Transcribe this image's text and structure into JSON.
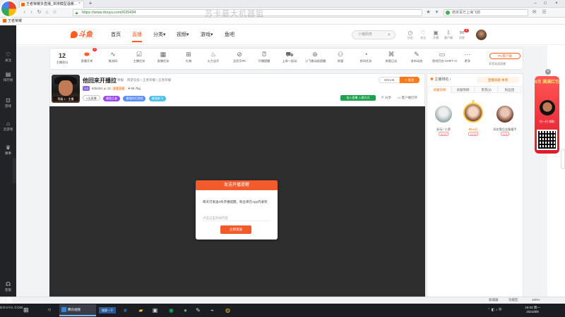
{
  "browser": {
    "tab_title": "王者荣耀多直播_单排模型温暖...",
    "url": "https://www.douyu.com/635434",
    "search_engine_text": "南京百万上海飞鸽",
    "watermark": "苏卡最大机器狙",
    "bookmark": "王者荣耀"
  },
  "sidebar": {
    "items": [
      {
        "icon": "heart-icon",
        "label": "关注"
      },
      {
        "icon": "list-icon",
        "label": "排行榜"
      },
      {
        "icon": "gamepad-icon",
        "label": "游戏"
      },
      {
        "icon": "store-icon",
        "label": "云游戏"
      },
      {
        "icon": "trophy-icon",
        "label": "赛事"
      },
      {
        "icon": "headset-icon",
        "label": "客服"
      }
    ]
  },
  "nav": {
    "items": [
      "首页",
      "直播",
      "分类",
      "视频",
      "游戏",
      "鱼吧"
    ],
    "search_placeholder": "小猪佩奇",
    "header_icons": [
      "历史",
      "关注",
      "开播",
      "客户端",
      "消息"
    ]
  },
  "features": {
    "level_num": "12",
    "level_label": "主播积分",
    "badge": "2",
    "items": [
      "直播开关",
      "推流码",
      "主播任务",
      "直播任务",
      "礼物",
      "火力全开",
      "全民乐PK",
      "开播提醒",
      "上车一起玩",
      "小飞猪动画提醒",
      "房管",
      "房间任务",
      "房管日志",
      "发布动态",
      "鱼吧开启 SHIFT+C",
      "更多"
    ],
    "pc_client": "PC客户端",
    "pc_sub": "享受高清直播"
  },
  "room": {
    "title": "他回来开播拉",
    "tag": "举报",
    "category": "网游竞技 • 王者荣耀 • 王者荣耀",
    "id_pill": "1:3",
    "hot": "12",
    "uid_label": "635434",
    "report": "查看直播",
    "fans": "68.7kg",
    "level_text": "V 1 级人",
    "tags": [
      "V当直播",
      "最强王者",
      "最强的打游戏",
      "最强带飞"
    ],
    "follow_count": "345146",
    "follow_label": "关注",
    "fans_btn": "加入直播 入群方式",
    "share": "分享",
    "client_watch": "客户端打开",
    "avatar_level": "等级 1 · 主播"
  },
  "modal": {
    "title": "发送开播提醒",
    "desc": "每天可发送3条开播提醒，粉丝将在App内收到",
    "input_placeholder": "点击这里添加内容",
    "button": "立即发送"
  },
  "rightpanel": {
    "ranks_label": "主播排名",
    "weekly_label": "直播贡献 本周",
    "tabs": [
      "贡献日榜",
      "贡献周榜",
      "贵宾(2)",
      "粉丝团"
    ],
    "users": [
      {
        "name": "多玩 / 小萝",
        "badge": "LV.12"
      },
      {
        "name": "Blue风",
        "badge": "LV.15"
      },
      {
        "name": "风花雪月会看看手",
        "badge": "LV.9"
      }
    ]
  },
  "ad": {
    "title": "8月 满满红包",
    "scan": "扫一扫 领取",
    "close": "×"
  },
  "status": {
    "zoom": "100%",
    "text1": "加速器",
    "text2": "功能区"
  },
  "taskbar": {
    "app_label": "腾讯视频",
    "tip_label": "搜索一下",
    "time": "15:03 周一",
    "date": "2021/8/9"
  },
  "overlay": {
    "brand": "斗鱼",
    "brand_sub": "DOUYU.COM"
  }
}
